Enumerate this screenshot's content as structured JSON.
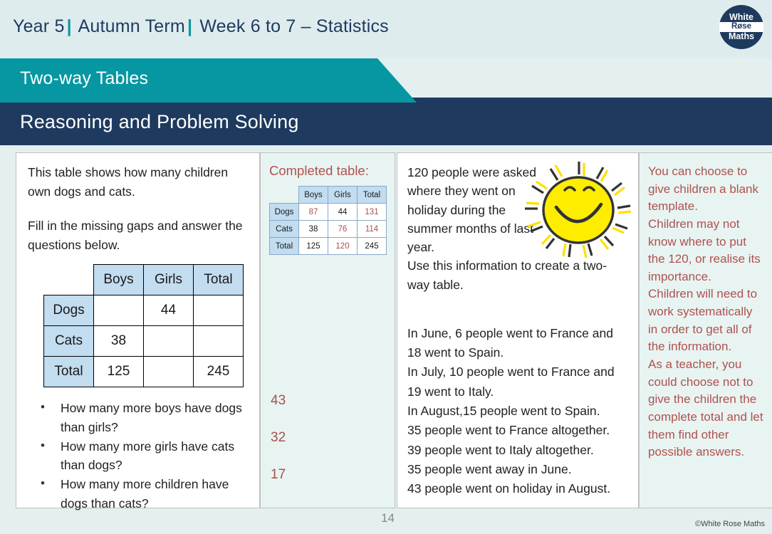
{
  "header": {
    "year": "Year 5",
    "term": "Autumn Term",
    "week": "Week 6 to 7 – Statistics",
    "separator": "|",
    "logo": {
      "line1": "White",
      "line2": "Røse",
      "line3": "Maths"
    }
  },
  "banners": {
    "topic": "Two-way Tables",
    "section": "Reasoning and Problem Solving"
  },
  "question_panel": {
    "intro_line1": "This table shows how many children",
    "intro_line2": "own dogs and cats.",
    "instruction": "Fill in the missing gaps and answer the questions below.",
    "table": {
      "col_headers": [
        "Boys",
        "Girls",
        "Total"
      ],
      "row_headers": [
        "Dogs",
        "Cats",
        "Total"
      ],
      "rows": [
        [
          "",
          "44",
          ""
        ],
        [
          "38",
          "",
          ""
        ],
        [
          "125",
          "",
          "245"
        ]
      ]
    },
    "questions": [
      "How many more boys have dogs than girls?",
      "How many more girls have cats than dogs?",
      "How many more children have dogs than cats?"
    ]
  },
  "answer_panel": {
    "title": "Completed table:",
    "table": {
      "col_headers": [
        "Boys",
        "Girls",
        "Total"
      ],
      "row_headers": [
        "Dogs",
        "Cats",
        "Total"
      ],
      "rows": [
        [
          {
            "v": "87",
            "a": true
          },
          {
            "v": "44",
            "a": false
          },
          {
            "v": "131",
            "a": true
          }
        ],
        [
          {
            "v": "38",
            "a": false
          },
          {
            "v": "76",
            "a": true
          },
          {
            "v": "114",
            "a": true
          }
        ],
        [
          {
            "v": "125",
            "a": false
          },
          {
            "v": "120",
            "a": true
          },
          {
            "v": "245",
            "a": false
          }
        ]
      ]
    },
    "answers": [
      "43",
      "32",
      "17"
    ]
  },
  "context_panel": {
    "intro": "120 people were asked where they went on holiday during the summer months of last year.",
    "instruction": "Use this information to create a two-way table.",
    "facts": [
      "In June, 6 people went to France and 18 went to Spain.",
      "In July, 10 people went to France and 19 went to Italy.",
      "In August,15 people went to Spain.",
      "35 people went to France altogether.",
      "39 people went to Italy altogether.",
      "35 people went away in June.",
      "43 people went on holiday in August."
    ]
  },
  "notes_panel": {
    "paragraphs": [
      "You can choose to give children a blank template.",
      "Children may not know where to put the 120, or realise its importance.",
      "Children will need to work systematically in order to get all of the information.",
      "As a teacher, you could choose not to give the children the complete total and let them find other possible answers."
    ]
  },
  "footer": {
    "page_number": "14",
    "copyright": "©White Rose Maths"
  },
  "colors": {
    "page_background": "#e4f0f0",
    "navy": "#1e3a5f",
    "teal": "#0697a3",
    "answer_red": "#a9504e",
    "table_header_blue": "#c2dcf0",
    "panel_mint": "#e8f4f2"
  }
}
